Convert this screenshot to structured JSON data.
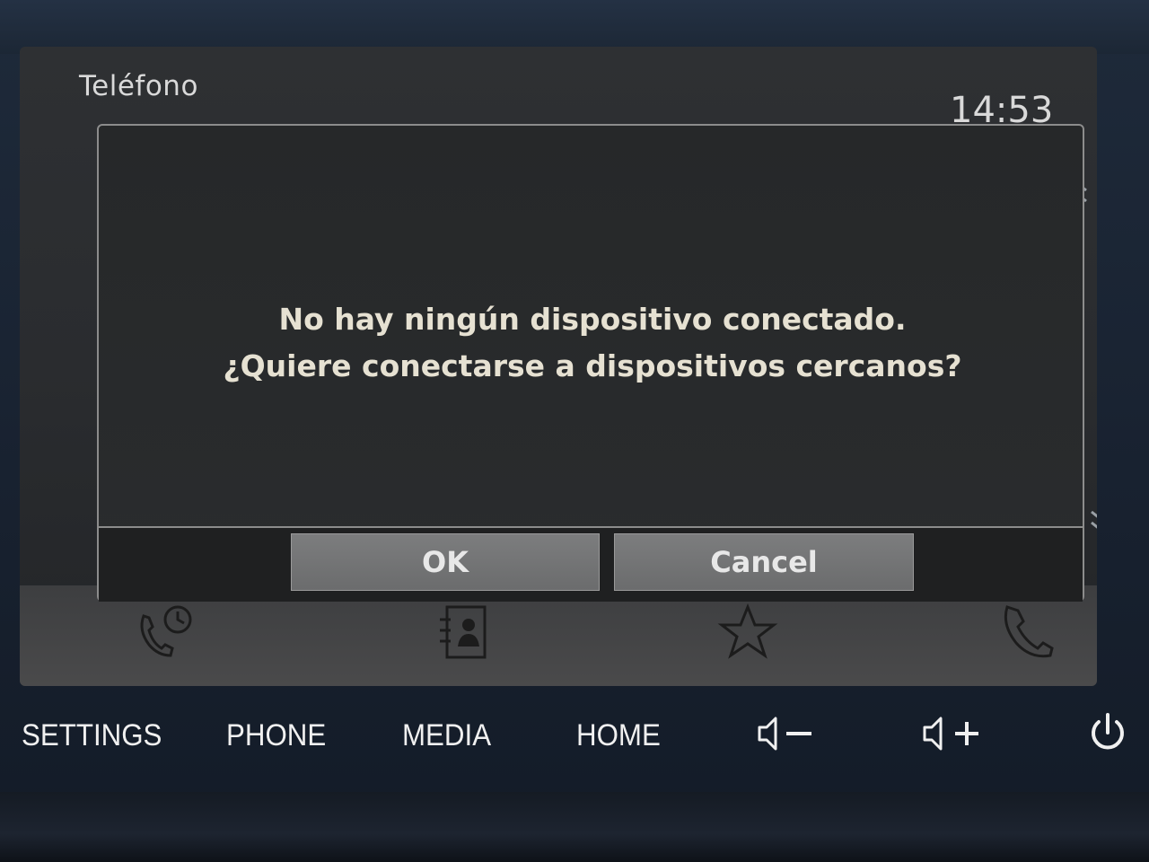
{
  "screen": {
    "title": "Teléfono",
    "clock": "14:53"
  },
  "dialog": {
    "line1": "No hay ningún dispositivo conectado.",
    "line2": "¿Quiere conectarse a dispositivos cercanos?",
    "ok_label": "OK",
    "cancel_label": "Cancel"
  },
  "tabs": [
    {
      "icon": "call-history-icon"
    },
    {
      "icon": "contacts-icon"
    },
    {
      "icon": "favorites-star-icon"
    },
    {
      "icon": "phone-handset-icon"
    }
  ],
  "hardware_buttons": {
    "settings": "SETTINGS",
    "phone": "PHONE",
    "media": "MEDIA",
    "home": "HOME",
    "volume_down_icon": "volume-down-icon",
    "volume_up_icon": "volume-up-icon",
    "power_icon": "power-icon"
  },
  "colors": {
    "dialog_text": "#e6e1d2",
    "button_bg": "#747576",
    "screen_bg": "#2a2c2f"
  }
}
